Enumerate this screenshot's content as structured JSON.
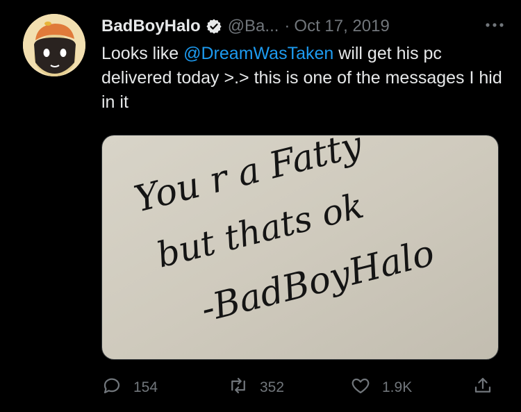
{
  "author": {
    "display_name": "BadBoyHalo",
    "handle": "@Ba...",
    "separator": "·",
    "date": "Oct 17, 2019"
  },
  "tweet": {
    "text_before": "Looks like ",
    "mention": "@DreamWasTaken",
    "text_after": " will get his pc delivered today >.> this is one of the messages I hid in it"
  },
  "media": {
    "note_lines": [
      "You r a Fatty",
      "but thats ok",
      "-BadBoyHalo"
    ]
  },
  "actions": {
    "replies": "154",
    "retweets": "352",
    "likes": "1.9K"
  },
  "colors": {
    "background": "#000000",
    "text": "#e7e9ea",
    "secondary": "#71767b",
    "accent": "#1d9bf0"
  },
  "icons": {
    "verified": "verified-badge-icon",
    "more": "more-dots-icon",
    "reply": "reply-bubble-icon",
    "retweet": "retweet-icon",
    "like": "heart-icon",
    "share": "share-icon"
  }
}
